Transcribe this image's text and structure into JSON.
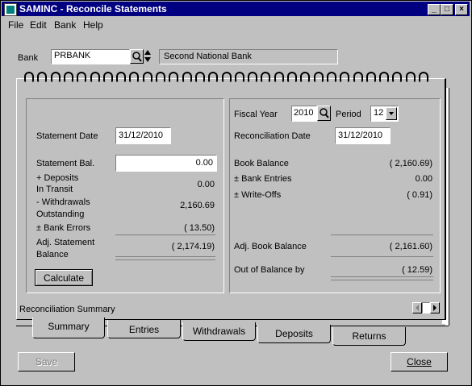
{
  "window": {
    "title": "SAMINC - Reconcile Statements"
  },
  "menu": [
    {
      "label": "File"
    },
    {
      "label": "Edit"
    },
    {
      "label": "Bank"
    },
    {
      "label": "Help"
    }
  ],
  "bank": {
    "label": "Bank",
    "code": "PRBANK",
    "name": "Second National Bank"
  },
  "left": {
    "statement_date_label": "Statement Date",
    "statement_date": "31/12/2010",
    "statement_bal_label": "Statement Bal.",
    "statement_bal": "0.00",
    "deposits_label_1": "+ Deposits",
    "deposits_label_2": "In Transit",
    "deposits_value": "0.00",
    "withdrawals_label_1": "- Withdrawals",
    "withdrawals_label_2": "Outstanding",
    "withdrawals_value": "2,160.69",
    "bank_errors_label": "± Bank Errors",
    "bank_errors_value": "(      13.50)",
    "adj_label_1": "Adj. Statement",
    "adj_label_2": "Balance",
    "adj_value": "(   2,174.19)",
    "calculate_label": "Calculate"
  },
  "right": {
    "fiscal_year_label": "Fiscal Year",
    "fiscal_year": "2010",
    "period_label": "Period",
    "period": "12",
    "recon_date_label": "Reconciliation Date",
    "recon_date": "31/12/2010",
    "book_balance_label": "Book Balance",
    "book_balance_value": "(   2,160.69)",
    "bank_entries_label": "± Bank Entries",
    "bank_entries_value": "0.00",
    "write_offs_label": "± Write-Offs",
    "write_offs_value": "(      0.91)",
    "adj_book_label": "Adj. Book Balance",
    "adj_book_value": "(   2,161.60)",
    "out_of_balance_label": "Out of Balance by",
    "out_of_balance_value": "(      12.59)"
  },
  "summary_caption": "Reconciliation Summary",
  "tabs": [
    {
      "label": "Summary"
    },
    {
      "label": "Entries"
    },
    {
      "label": "Withdrawals"
    },
    {
      "label": "Deposits"
    },
    {
      "label": "Returns"
    }
  ],
  "buttons": {
    "save": "Save",
    "close": "Close"
  }
}
